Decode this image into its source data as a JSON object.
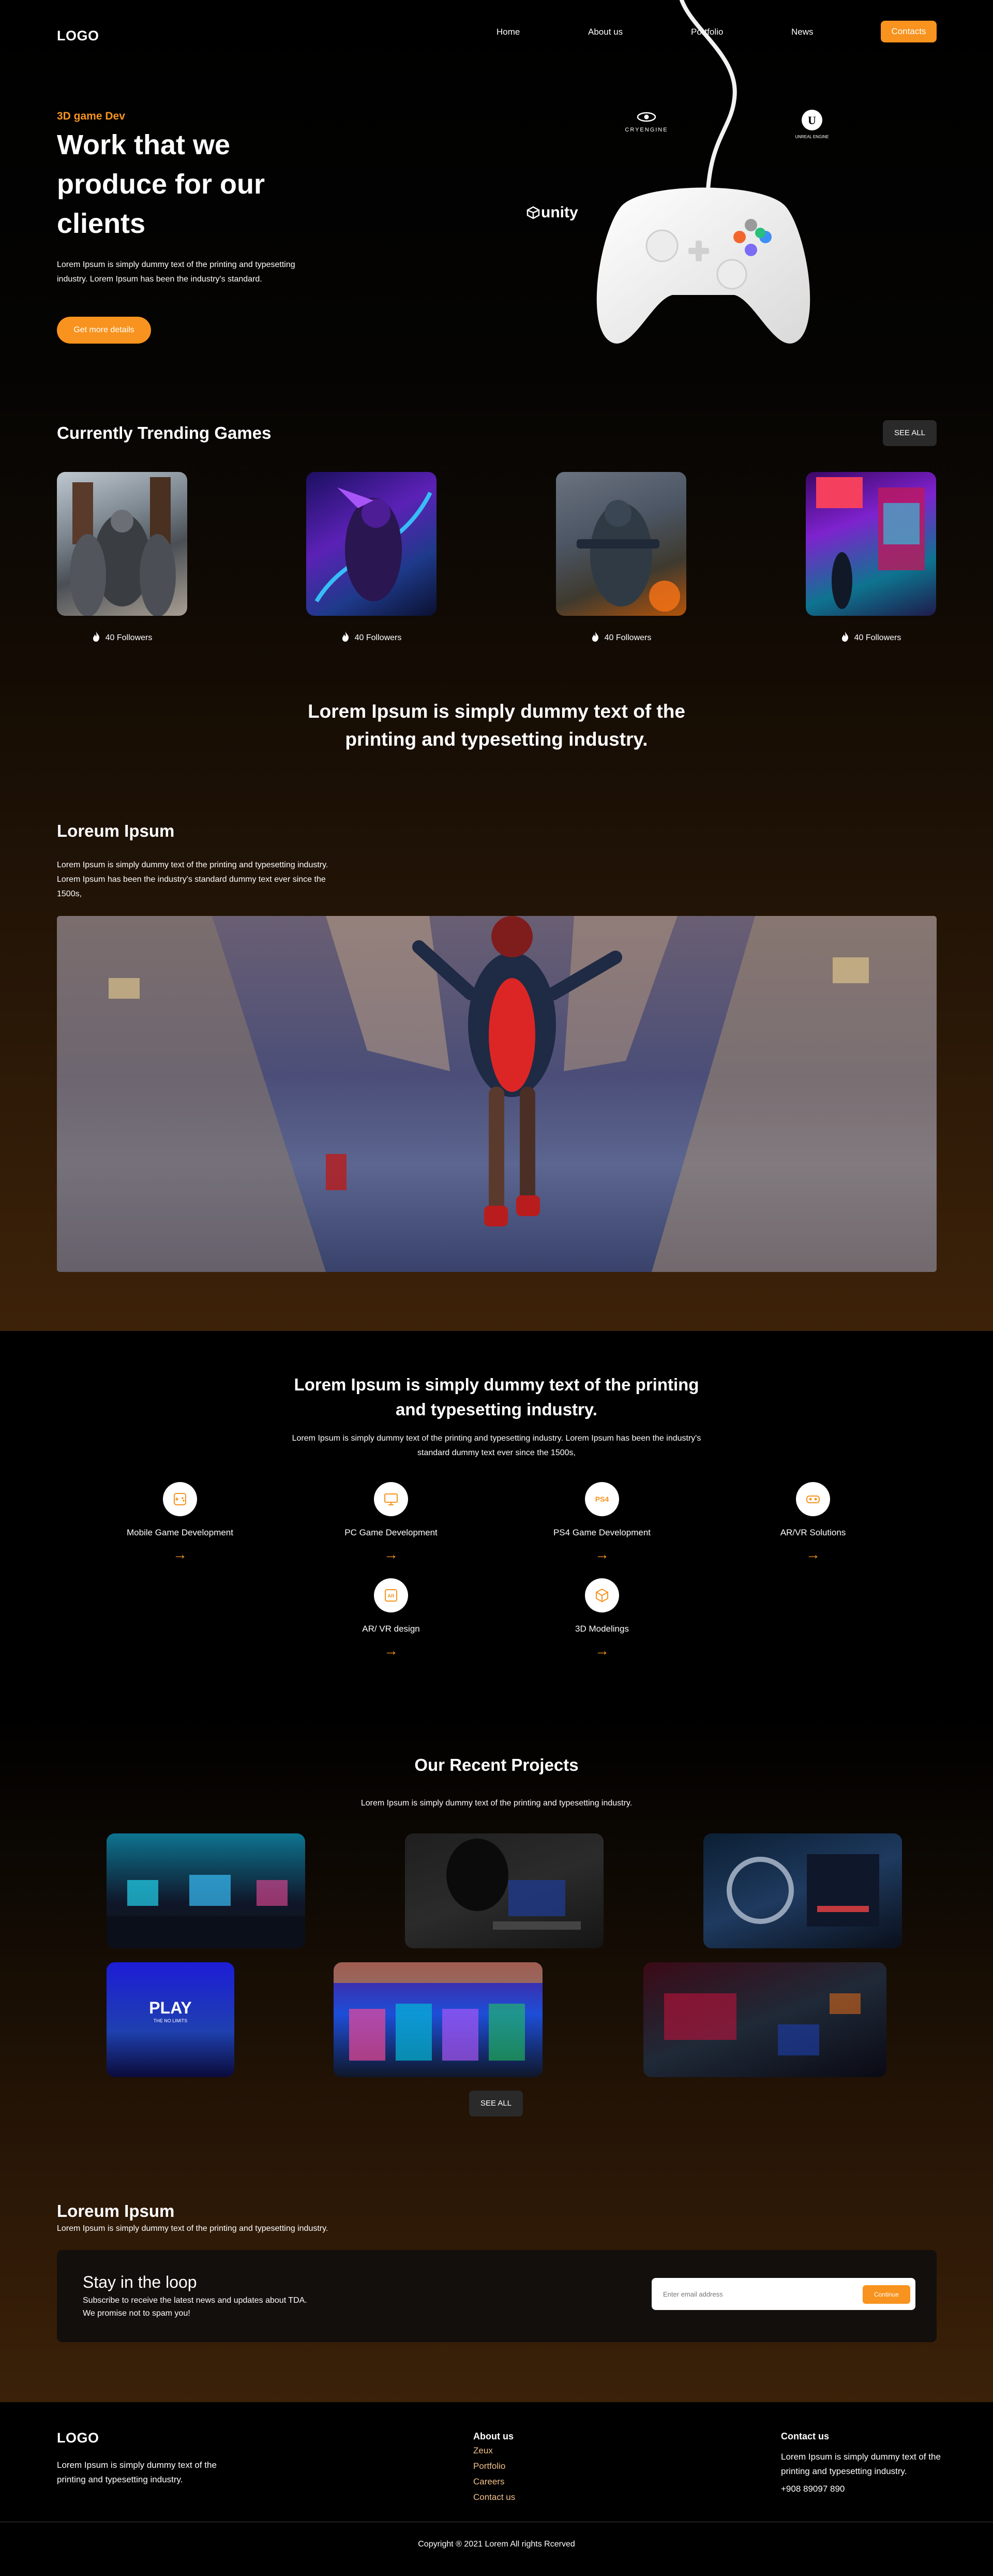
{
  "nav": {
    "logo": "LOGO",
    "links": [
      "Home",
      "About us",
      "Portfolio",
      "News"
    ],
    "cta": "Contacts"
  },
  "hero": {
    "eyebrow": "3D game Dev",
    "title": "Work that we produce for our clients",
    "text": "Lorem Ipsum is simply dummy text of the printing and typesetting industry. Lorem Ipsum has been the industry's standard.",
    "button": "Get more details",
    "brands": {
      "cryengine": "CRYENGINE",
      "unreal": "UNREAL ENGINE",
      "unity": "unity"
    }
  },
  "trending": {
    "title": "Currently Trending Games",
    "see_all": "SEE ALL",
    "games": [
      {
        "followers": "40 Followers"
      },
      {
        "followers": "40 Followers"
      },
      {
        "followers": "40 Followers"
      },
      {
        "followers": "40 Followers"
      }
    ]
  },
  "headline1": "Lorem Ipsum is simply dummy text of the printing and typesetting industry.",
  "feature": {
    "title": "Loreum Ipsum",
    "text": "Lorem Ipsum is simply dummy text of the printing and typesetting industry. Lorem Ipsum has been the industry's standard dummy text ever since the 1500s,"
  },
  "services": {
    "title": "Lorem Ipsum is simply dummy text of the printing and typesetting industry.",
    "text": "Lorem Ipsum is simply dummy text of the printing and typesetting industry. Lorem Ipsum has been the industry's standard dummy text ever since the 1500s,",
    "items": [
      {
        "label": "Mobile Game Development",
        "icon": "mobile-icon"
      },
      {
        "label": "PC Game Development",
        "icon": "pc-icon"
      },
      {
        "label": "PS4 Game Development",
        "icon": "ps4-icon"
      },
      {
        "label": "AR/VR Solutions",
        "icon": "vr-headset-icon"
      },
      {
        "label": "AR/ VR design",
        "icon": "ar-design-icon"
      },
      {
        "label": "3D Modelings",
        "icon": "3d-model-icon"
      }
    ],
    "arrow": "→"
  },
  "projects": {
    "title": "Our Recent Projects",
    "text": "Lorem Ipsum is simply dummy text of the printing and typesetting industry.",
    "play_title": "PLAY",
    "play_sub": "THE NO LIMITS",
    "see_all": "SEE ALL"
  },
  "newsletter": {
    "heading": "Loreum Ipsum",
    "subheading": "Lorem Ipsum is simply dummy text of the printing and typesetting industry.",
    "title": "Stay in the loop",
    "line1": "Subscribe to receive the latest news and updates about TDA.",
    "line2": "We promise not to spam you!",
    "placeholder": "Enter email address",
    "button": "Continue"
  },
  "footer": {
    "logo": "LOGO",
    "tagline": "Lorem Ipsum is simply dummy text of the printing and typesetting industry.",
    "about_title": "About us",
    "about_links": [
      "Zeux",
      "Portfolio",
      "Careers",
      "Contact us"
    ],
    "contact_title": "Contact us",
    "contact_text": "Lorem Ipsum is simply dummy text of the printing and typesetting industry.",
    "phone": "+908 89097 890",
    "copyright": "Copyright ® 2021 Lorem All rights Rcerved"
  },
  "colors": {
    "accent": "#f7931e",
    "background": "#000000",
    "card": "#130f0c"
  }
}
